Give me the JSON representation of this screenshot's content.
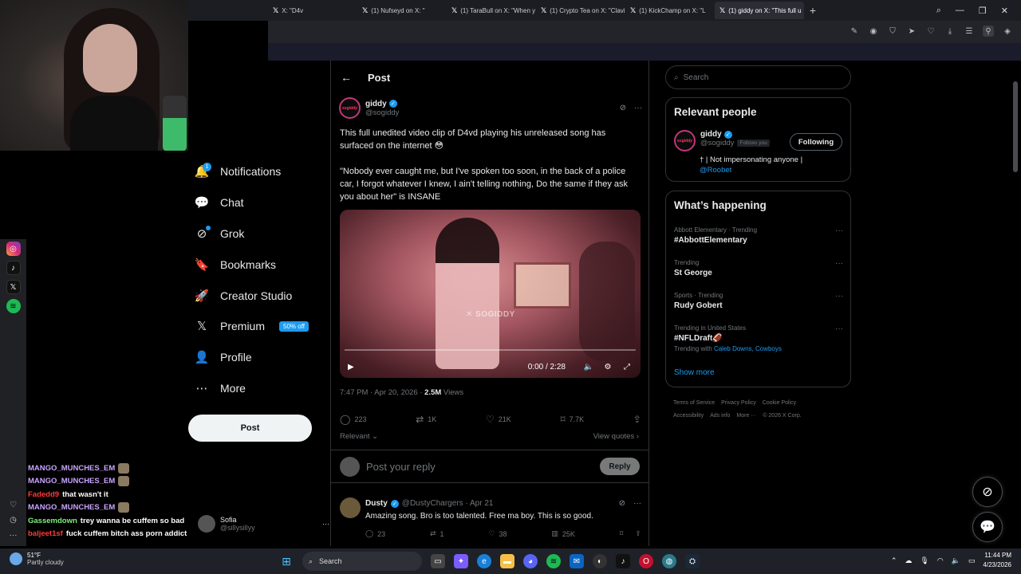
{
  "browser": {
    "tabs": [
      {
        "label": "X: \"D4v"
      },
      {
        "label": "(1) Nufseyd on X: \""
      },
      {
        "label": "(1) TaraBull on X: \"When y"
      },
      {
        "label": "(1) Crypto Tea on X: \"Clavi"
      },
      {
        "label": "(1) KickChamp on X: \"L"
      },
      {
        "label": "(1) giddy on X: \"This full u"
      }
    ],
    "new_tab": "+",
    "window_controls": {
      "search": "⌕",
      "minimize": "—",
      "maximize": "❐",
      "close": "✕"
    }
  },
  "nav": {
    "items": [
      {
        "label": "Notifications",
        "icon": "bell-icon",
        "glyph": "🔔",
        "badge": "1"
      },
      {
        "label": "Chat",
        "icon": "chat-icon",
        "glyph": "💬"
      },
      {
        "label": "Grok",
        "icon": "grok-icon",
        "glyph": "⊘"
      },
      {
        "label": "Bookmarks",
        "icon": "bookmark-icon",
        "glyph": "🔖"
      },
      {
        "label": "Creator Studio",
        "icon": "rocket-icon",
        "glyph": "🚀"
      },
      {
        "label": "Premium",
        "icon": "x-logo-icon",
        "glyph": "𝕏",
        "badge": "50% off"
      },
      {
        "label": "Profile",
        "icon": "person-icon",
        "glyph": "👤"
      },
      {
        "label": "More",
        "icon": "more-circle-icon",
        "glyph": "⋯"
      }
    ],
    "post_button": "Post"
  },
  "chat": [
    {
      "name": "MANGO_MUNCHES_EM",
      "color": "#c9a4ff",
      "msg": "",
      "emote": true
    },
    {
      "name": "MANGO_MUNCHES_EM",
      "color": "#c9a4ff",
      "msg": "",
      "emote": true
    },
    {
      "name": "Fadedd9",
      "color": "#ff3b3b",
      "msg": "that wasn't it",
      "emote": false
    },
    {
      "name": "MANGO_MUNCHES_EM",
      "color": "#c9a4ff",
      "msg": "",
      "emote": true
    },
    {
      "name": "Gassemdown",
      "color": "#7cf27c",
      "msg": "trey wanna be cuffem so bad",
      "emote": false
    },
    {
      "name": "baljeet1sf",
      "color": "#ff3b3b",
      "msg": "fuck cuffem bitch ass porn addict",
      "emote": false
    }
  ],
  "side_account": {
    "name": "Sofia",
    "handle": "@sillysillyy",
    "more": "···"
  },
  "post": {
    "header": "Post",
    "author": {
      "name": "giddy",
      "handle": "@sogiddy",
      "avatar_text": "sogiddy"
    },
    "text_1": "This full unedited video clip of D4vd playing his unreleased song has surfaced on the internet 😳",
    "text_2": "\"Nobody ever caught me, but I've spoken too soon, in the back of a police car, I forgot whatever I knew, I ain't telling nothing, Do the same if they ask you about her\" is INSANE",
    "video": {
      "watermark": "SOGIDDY",
      "time": "0:00 / 2:28",
      "progress": 0
    },
    "timestamp": "7:47 PM · Apr 20, 2026 · ",
    "views_count": "2.5M",
    "views_label": " Views",
    "metrics": {
      "replies": "223",
      "reposts": "1K",
      "likes": "21K",
      "bookmarks": "7.7K"
    },
    "relevant": "Relevant ⌄",
    "view_quotes": "View quotes ›",
    "reply_placeholder": "Post your reply",
    "reply_button": "Reply"
  },
  "reply": {
    "name": "Dusty",
    "handle": "@DustyChargers · Apr 21",
    "text": "Amazing song. Bro is too talented. Free ma boy. This is so good.",
    "metrics": {
      "replies": "23",
      "reposts": "1",
      "likes": "38",
      "views": "25K"
    }
  },
  "search": {
    "placeholder": "Search"
  },
  "relevant_people": {
    "title": "Relevant people",
    "name": "giddy",
    "handle": "@sogiddy",
    "follows_you": "Follows you",
    "button": "Following",
    "bio": "† | Not impersonating anyone |",
    "bio_link": "@Roobet"
  },
  "whats_happening": {
    "title": "What’s happening",
    "trends": [
      {
        "context": "Abbott Elementary · Trending",
        "title": "#AbbottElementary"
      },
      {
        "context": "Trending",
        "title": "St George"
      },
      {
        "context": "Sports · Trending",
        "title": "Rudy Gobert"
      },
      {
        "context": "Trending in United States",
        "title": "#NFLDraft🏈",
        "with_prefix": "Trending with ",
        "with_links": "Caleb Downs, Cowboys"
      }
    ],
    "show_more": "Show more"
  },
  "footer": {
    "line1": [
      "Terms of Service",
      "Privacy Policy",
      "Cookie Policy"
    ],
    "line2": [
      "Accessibility",
      "Ads info",
      "More ···",
      "© 2026 X Corp."
    ]
  },
  "taskbar": {
    "weather_temp": "51°F",
    "weather_desc": "Partly cloudy",
    "search": "Search",
    "time": "11:44 PM",
    "date": "4/23/2026"
  }
}
